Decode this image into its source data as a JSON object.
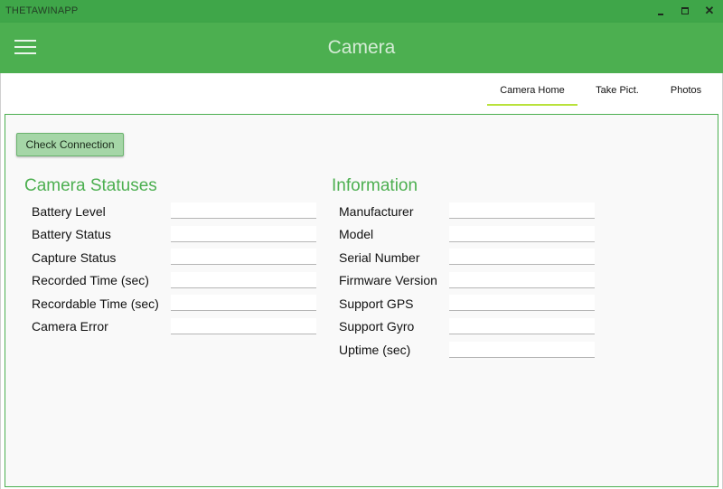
{
  "window": {
    "title": "THETAWINAPP",
    "close_glyph": "✕"
  },
  "header": {
    "title": "Camera",
    "menu_icon": "hamburger-icon"
  },
  "tabs": [
    {
      "label": "Camera Home",
      "active": true
    },
    {
      "label": "Take Pict.",
      "active": false
    },
    {
      "label": "Photos",
      "active": false
    }
  ],
  "actions": {
    "check_connection": "Check Connection"
  },
  "camera_statuses": {
    "title": "Camera Statuses",
    "rows": [
      {
        "label": "Battery Level",
        "value": ""
      },
      {
        "label": "Battery Status",
        "value": ""
      },
      {
        "label": "Capture Status",
        "value": ""
      },
      {
        "label": "Recorded Time (sec)",
        "value": ""
      },
      {
        "label": "Recordable Time (sec)",
        "value": ""
      },
      {
        "label": "Camera Error",
        "value": ""
      }
    ]
  },
  "information": {
    "title": "Information",
    "rows": [
      {
        "label": "Manufacturer",
        "value": ""
      },
      {
        "label": "Model",
        "value": ""
      },
      {
        "label": "Serial Number",
        "value": ""
      },
      {
        "label": "Firmware Version",
        "value": ""
      },
      {
        "label": "Support GPS",
        "value": ""
      },
      {
        "label": "Support Gyro",
        "value": ""
      },
      {
        "label": "Uptime (sec)",
        "value": ""
      }
    ]
  },
  "colors": {
    "titlebar": "#3fa649",
    "header": "#4caf50",
    "accent": "#4caf50",
    "tab_indicator": "#b9e23b",
    "button": "#a5d6a7"
  }
}
